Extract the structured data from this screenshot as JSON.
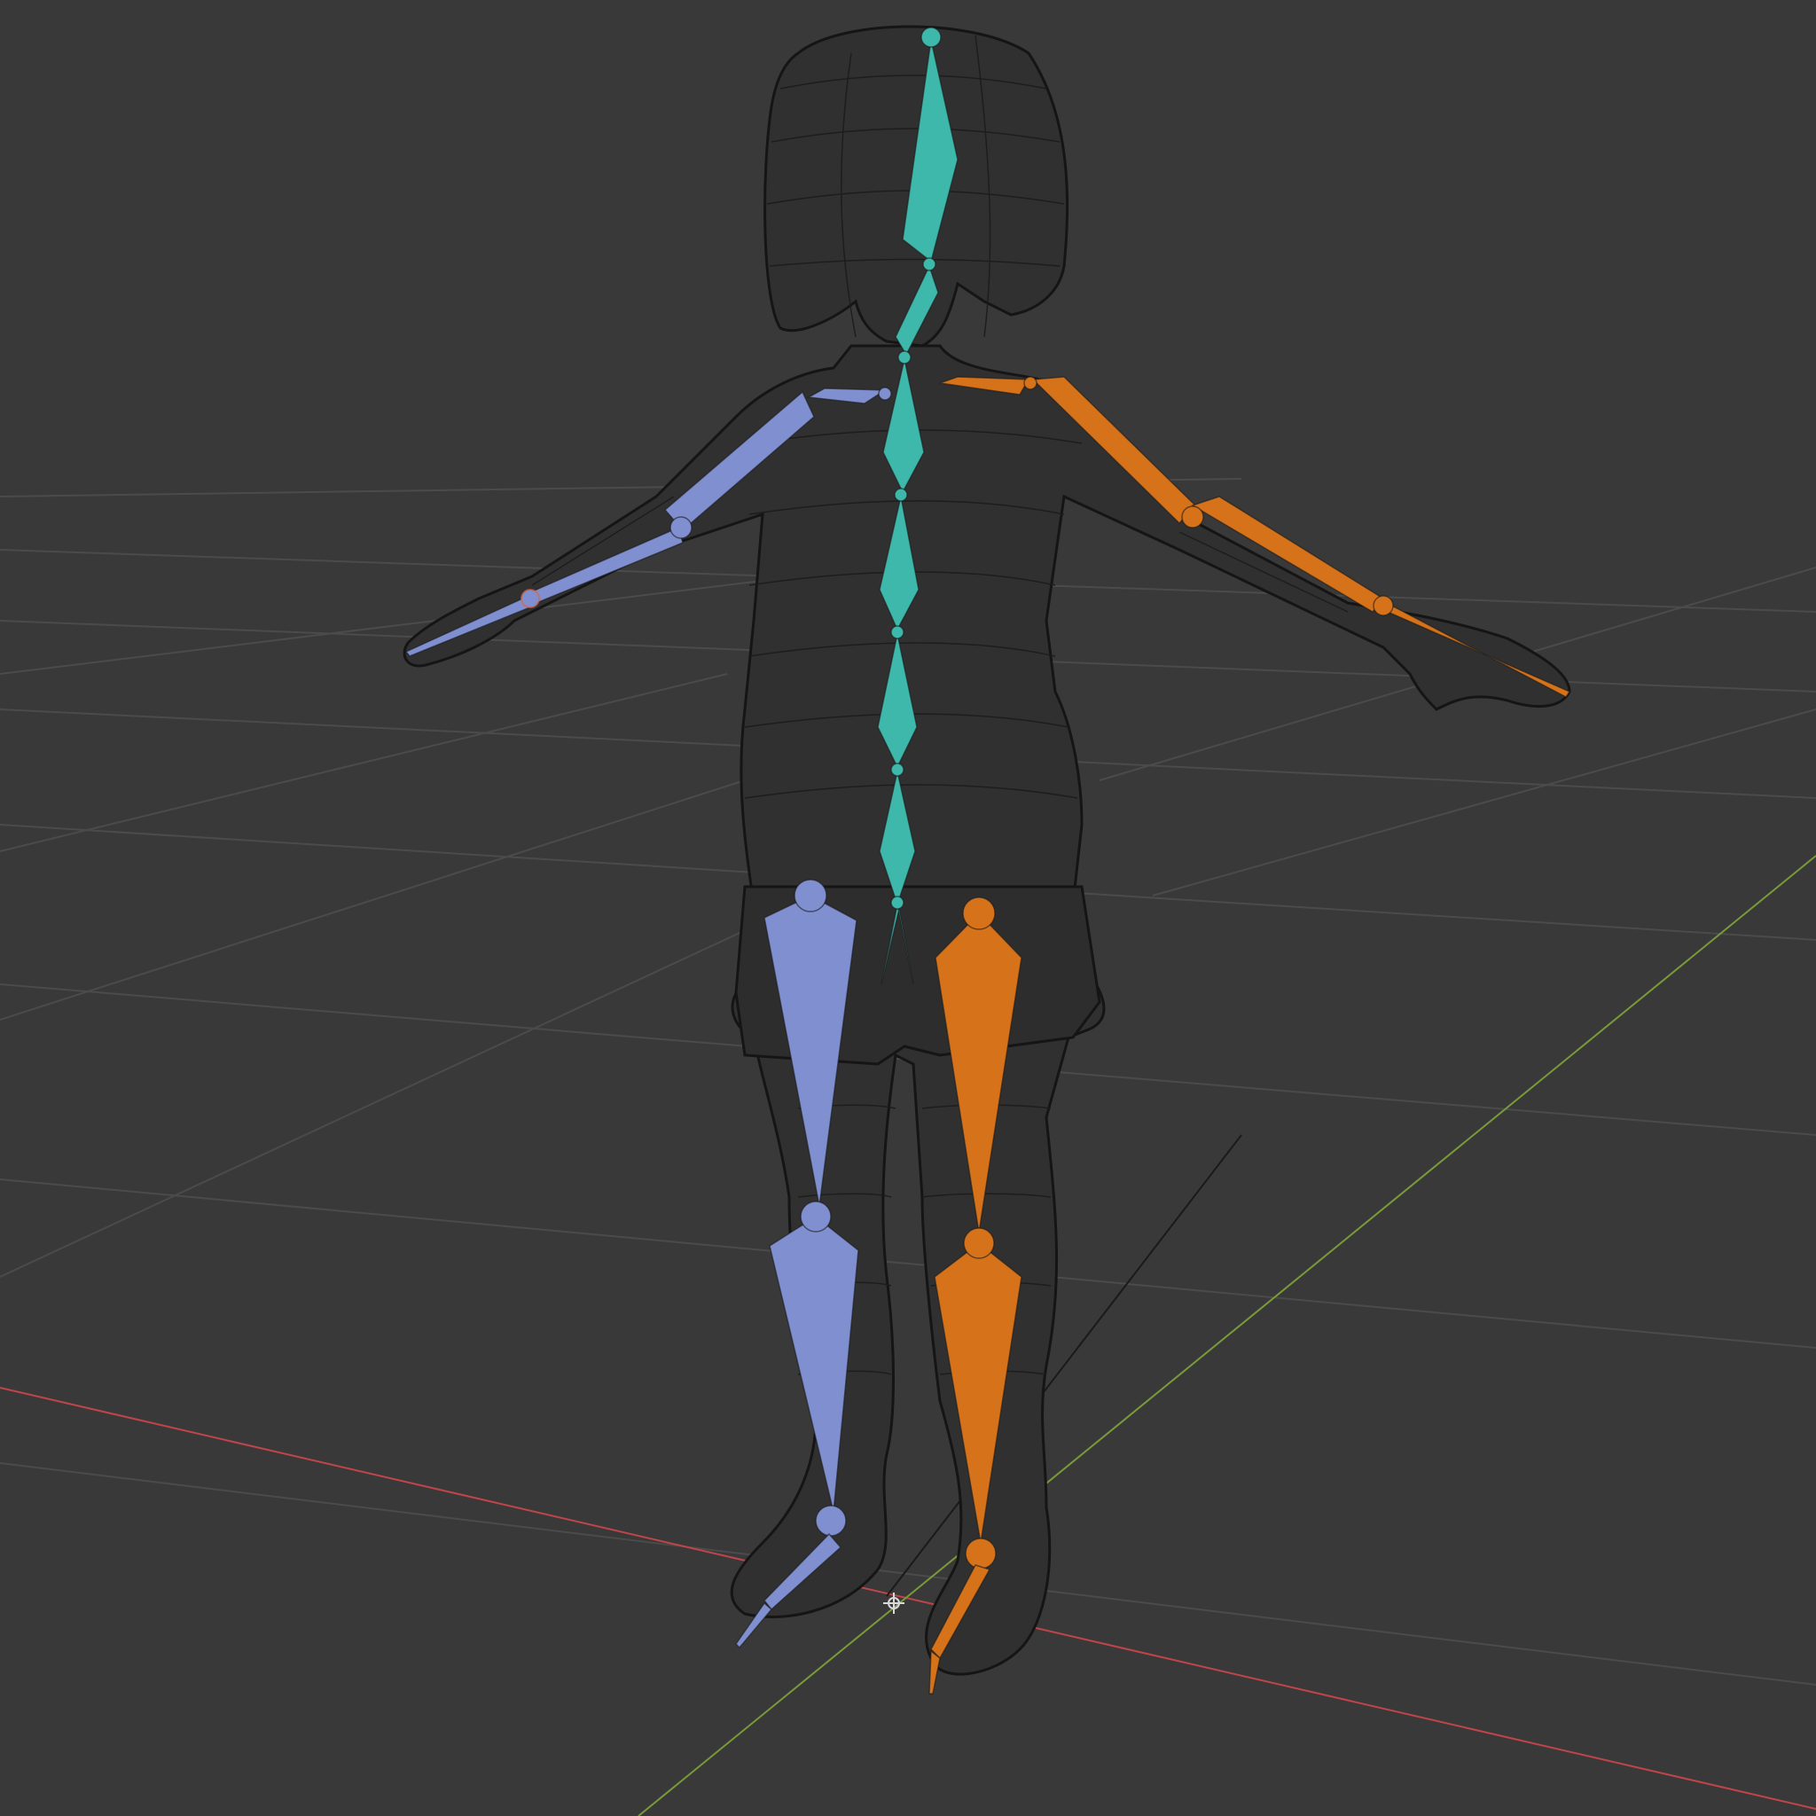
{
  "viewport": {
    "background": "#393939",
    "grid_color": "#4a4a4a",
    "x_axis_color": "#c0454a",
    "y_axis_color": "#7a9a3a"
  },
  "mesh": {
    "color": "#111111",
    "display": "wireframe"
  },
  "armature": {
    "colors": {
      "center": "#3fb8ac",
      "left": "#7f8fd0",
      "right": "#d6731a"
    },
    "bones": [
      "head",
      "neck",
      "spine-upper",
      "spine-mid",
      "spine-lower",
      "spine-base",
      "hips",
      "shoulder-l",
      "upper-arm-l",
      "forearm-l",
      "hand-l",
      "shoulder-r",
      "upper-arm-r",
      "forearm-r",
      "hand-r",
      "thigh-l",
      "shin-l",
      "foot-l",
      "toe-l",
      "thigh-r",
      "shin-r",
      "foot-r",
      "toe-r"
    ]
  }
}
